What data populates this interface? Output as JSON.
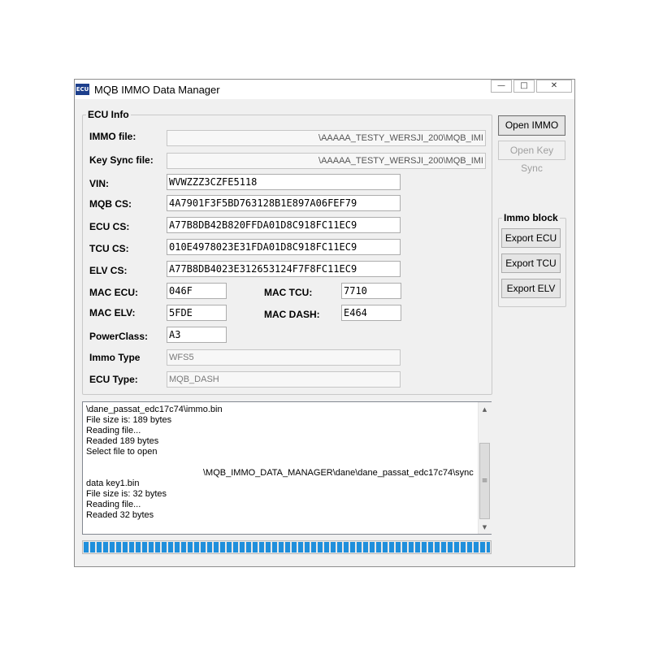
{
  "window": {
    "title": "MQB IMMO Data Manager",
    "icon_text": "ECU",
    "controls": {
      "minimize": "—",
      "maximize": "□",
      "close": "✕"
    }
  },
  "ecu_info": {
    "group_title": "ECU Info",
    "immo_file": {
      "label": "IMMO file:",
      "value": "\\AAAAA_TESTY_WERSJI_200\\MQB_IMI"
    },
    "key_sync_file": {
      "label": "Key Sync file:",
      "value": "\\AAAAA_TESTY_WERSJI_200\\MQB_IMI"
    },
    "vin": {
      "label": "VIN:",
      "value": "WVWZZZ3CZFE5118"
    },
    "mqb_cs": {
      "label": "MQB CS:",
      "value": "4A7901F3F5BD763128B1E897A06FEF79"
    },
    "ecu_cs": {
      "label": "ECU CS:",
      "value": "A77B8DB42B820FFDA01D8C918FC11EC9"
    },
    "tcu_cs": {
      "label": "TCU CS:",
      "value": "010E4978023E31FDA01D8C918FC11EC9"
    },
    "elv_cs": {
      "label": "ELV CS:",
      "value": "A77B8DB4023E312653124F7F8FC11EC9"
    },
    "mac_ecu": {
      "label": "MAC ECU:",
      "value": "046F"
    },
    "mac_tcu": {
      "label": "MAC TCU:",
      "value": "7710"
    },
    "mac_elv": {
      "label": "MAC ELV:",
      "value": "5FDE"
    },
    "mac_dash": {
      "label": "MAC DASH:",
      "value": "E464"
    },
    "power_class": {
      "label": "PowerClass:",
      "value": "A3"
    },
    "immo_type": {
      "label": "Immo Type",
      "value": "WFS5"
    },
    "ecu_type": {
      "label": "ECU Type:",
      "value": "MQB_DASH"
    }
  },
  "buttons": {
    "open_immo": "Open IMMO",
    "open_key_sync": "Open Key Sync"
  },
  "immo_block": {
    "group_title": "Immo block",
    "export_ecu": "Export ECU",
    "export_tcu": "Export TCU",
    "export_elv": "Export ELV"
  },
  "log": {
    "lines": [
      "\\dane_passat_edc17c74\\immo.bin",
      "File size is: 189 bytes",
      "Reading file...",
      "Readed 189 bytes",
      "Select file to open",
      "",
      "\\MQB_IMMO_DATA_MANAGER\\dane\\dane_passat_edc17c74\\sync",
      "data key1.bin",
      "File size is: 32 bytes",
      "Reading file...",
      "Readed 32 bytes"
    ]
  },
  "scrollbar": {
    "up": "▲",
    "down": "▼",
    "grip": "≡"
  },
  "progress": {
    "fraction": 1.0
  },
  "colors": {
    "progress": "#1f8fdc",
    "window_bg": "#f0f0f0",
    "icon_bg": "#1d3f8c"
  }
}
